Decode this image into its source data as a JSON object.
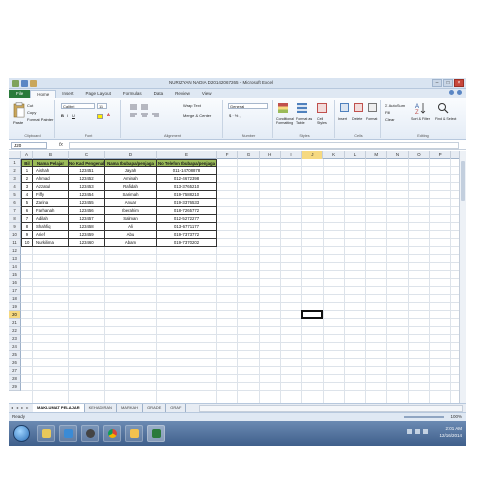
{
  "window": {
    "title": "NURIZYAN NADIA D20142067265 - Microsoft Excel"
  },
  "tabs": [
    "File",
    "Home",
    "Insert",
    "Page Layout",
    "Formulas",
    "Data",
    "Review",
    "View"
  ],
  "ribbon": {
    "clipboard": {
      "paste": "Paste",
      "cut": "Cut",
      "copy": "Copy",
      "format_painter": "Format Painter",
      "label": "Clipboard"
    },
    "font": {
      "name": "Calibri",
      "size": "11",
      "label": "Font"
    },
    "alignment": {
      "wrap": "Wrap Text",
      "merge": "Merge & Center",
      "label": "Alignment"
    },
    "number": {
      "format": "General",
      "label": "Number"
    },
    "styles": {
      "conditional": "Conditional Formatting",
      "format_table": "Format as Table",
      "cell_styles": "Cell Styles",
      "label": "Styles"
    },
    "cells": {
      "insert": "Insert",
      "delete": "Delete",
      "format": "Format",
      "label": "Cells"
    },
    "editing": {
      "autosum": "AutoSum",
      "fill": "Fill",
      "clear": "Clear",
      "sort": "Sort & Filter",
      "find": "Find & Select",
      "label": "Editing"
    }
  },
  "formula_bar": {
    "name_box": "J20",
    "fx": "fx",
    "formula": ""
  },
  "columns": [
    "A",
    "B",
    "C",
    "D",
    "E",
    "F",
    "G",
    "H",
    "I",
    "J",
    "K",
    "L",
    "M",
    "N",
    "O",
    "P"
  ],
  "selected_column": "J",
  "rows": [
    "1",
    "2",
    "3",
    "4",
    "5",
    "6",
    "7",
    "8",
    "9",
    "10",
    "11",
    "12",
    "13",
    "14",
    "15",
    "16",
    "17",
    "18",
    "19",
    "20",
    "21",
    "22",
    "23",
    "24",
    "25",
    "26",
    "27",
    "28",
    "29"
  ],
  "selected_row": "20",
  "table": {
    "headers": [
      "Bil",
      "Nama Pelajar",
      "No Kad Pengenalan",
      "Nama Ibubapa/penjaga",
      "No Telefon Ibubapa/penjaga"
    ],
    "rows": [
      [
        "1",
        "Aishah",
        "123451",
        "Jayah",
        "011-14708878"
      ],
      [
        "2",
        "Ahmad",
        "123452",
        "Aminah",
        "012-4672398"
      ],
      [
        "3",
        "Azzatul",
        "123453",
        "Rafidah",
        "013-3765210"
      ],
      [
        "4",
        "Fiffy",
        "123454",
        "Sarimah",
        "019-7588210"
      ],
      [
        "5",
        "Zarina",
        "123455",
        "Anuar",
        "019-3376533"
      ],
      [
        "6",
        "Farhanah",
        "123456",
        "Iberahim",
        "018-7265772"
      ],
      [
        "7",
        "Adilah",
        "123457",
        "Salman",
        "012-5272277"
      ],
      [
        "8",
        "Shahfiq",
        "123458",
        "Ali",
        "013-6771177"
      ],
      [
        "9",
        "Arief",
        "123459",
        "Abu",
        "019-7373772"
      ],
      [
        "10",
        "Nurkilima",
        "123460",
        "Abam",
        "019-7370202"
      ]
    ]
  },
  "sheets": [
    "MAKLUMAT PELAJAR",
    "KEHADIRAN",
    "MARKAH",
    "GRADE",
    "GRAF"
  ],
  "active_sheet": "MAKLUMAT PELAJAR",
  "sheet_nav": "◂ ◂ ▸ ▸",
  "status": {
    "ready": "Ready",
    "zoom": "100%"
  },
  "clock": {
    "time": "2:01 AM",
    "date": "12/16/2014"
  },
  "colors": {
    "header_fill": "#9bbb59",
    "file_tab": "#2a7a3b",
    "selection": "#f6d980"
  }
}
